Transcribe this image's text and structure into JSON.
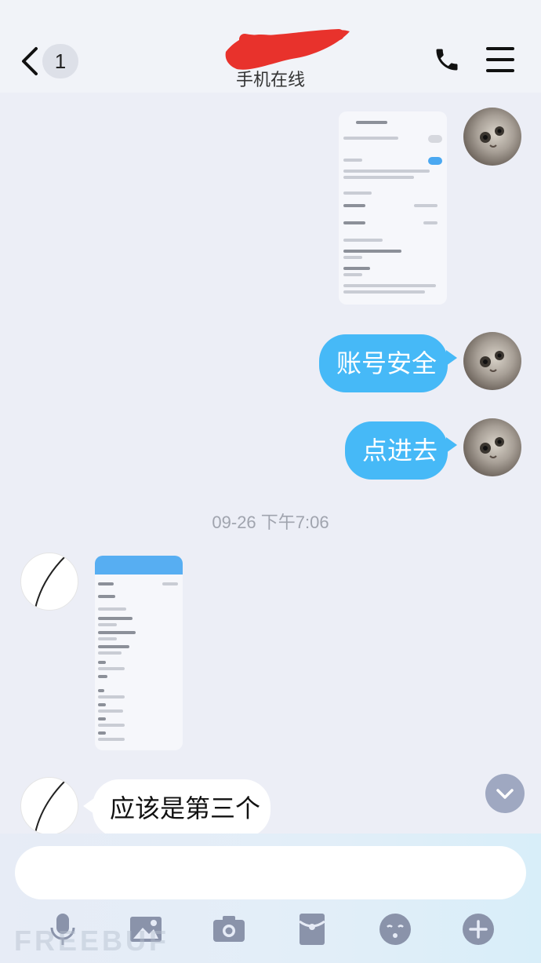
{
  "header": {
    "unread_count": "1",
    "contact_name": "",
    "status": "手机在线"
  },
  "messages": {
    "me_text_1": "账号安全",
    "me_text_2": "点进去",
    "timestamp": "09-26 下午7:06",
    "them_text_1": "应该是第三个"
  },
  "input": {
    "value": "",
    "placeholder": ""
  },
  "toolbar": {
    "icons": [
      "mic-icon",
      "image-icon",
      "camera-icon",
      "red-packet-icon",
      "emoji-icon",
      "plus-icon"
    ]
  },
  "watermark": "FREEBUF",
  "colors": {
    "my_bubble": "#46b9f7",
    "their_bubble": "#ffffff",
    "background": "#eceef6",
    "toolbar_icon": "#8a93aa",
    "redaction": "#e8322c"
  }
}
